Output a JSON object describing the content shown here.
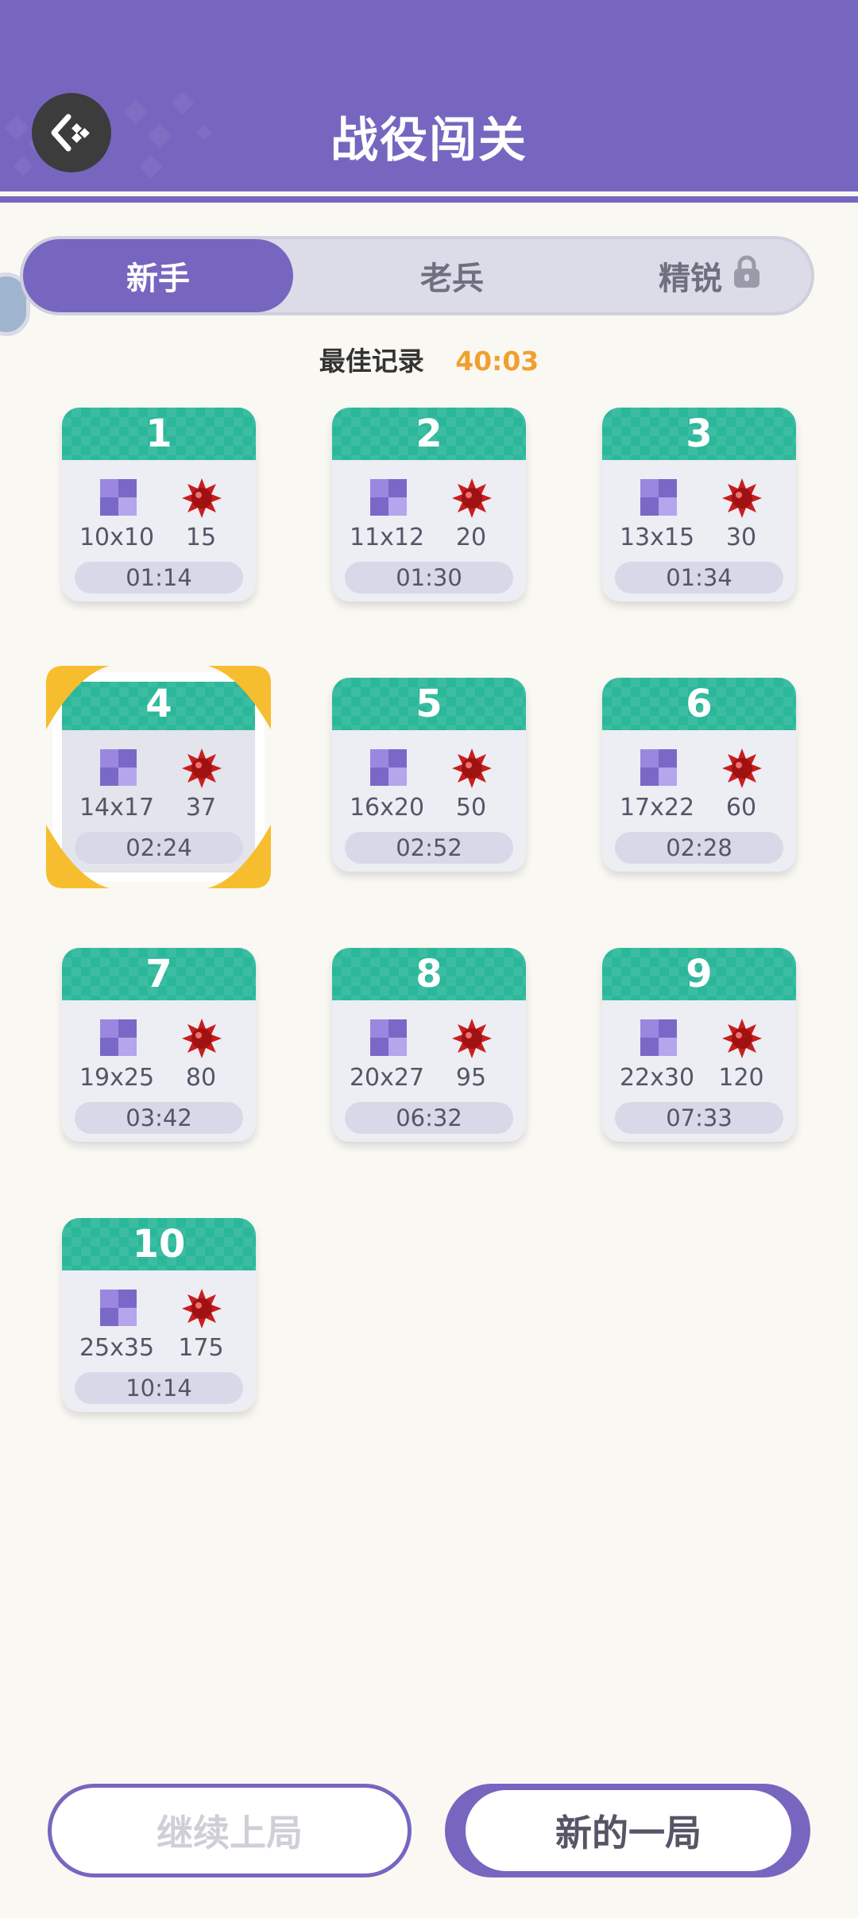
{
  "header": {
    "title": "战役闯关",
    "back_icon": "back-diamond-icon"
  },
  "tabs": [
    {
      "label": "新手",
      "active": true
    },
    {
      "label": "老兵",
      "active": false
    },
    {
      "label": "精锐",
      "active": false,
      "locked": true
    }
  ],
  "best_record": {
    "label": "最佳记录",
    "value": "40:03"
  },
  "levels": [
    {
      "num": "1",
      "size": "10x10",
      "mines": "15",
      "time": "01:14"
    },
    {
      "num": "2",
      "size": "11x12",
      "mines": "20",
      "time": "01:30"
    },
    {
      "num": "3",
      "size": "13x15",
      "mines": "30",
      "time": "01:34"
    },
    {
      "num": "4",
      "size": "14x17",
      "mines": "37",
      "time": "02:24",
      "selected": true
    },
    {
      "num": "5",
      "size": "16x20",
      "mines": "50",
      "time": "02:52"
    },
    {
      "num": "6",
      "size": "17x22",
      "mines": "60",
      "time": "02:28"
    },
    {
      "num": "7",
      "size": "19x25",
      "mines": "80",
      "time": "03:42"
    },
    {
      "num": "8",
      "size": "20x27",
      "mines": "95",
      "time": "06:32"
    },
    {
      "num": "9",
      "size": "22x30",
      "mines": "120",
      "time": "07:33"
    },
    {
      "num": "10",
      "size": "25x35",
      "mines": "175",
      "time": "10:14"
    }
  ],
  "buttons": {
    "continue_label": "继续上局",
    "new_label": "新的一局"
  },
  "colors": {
    "primary": "#7766C0",
    "card_header": "#2BB79A",
    "best_record": "#F0A030",
    "selection": "#F6BE2E"
  }
}
